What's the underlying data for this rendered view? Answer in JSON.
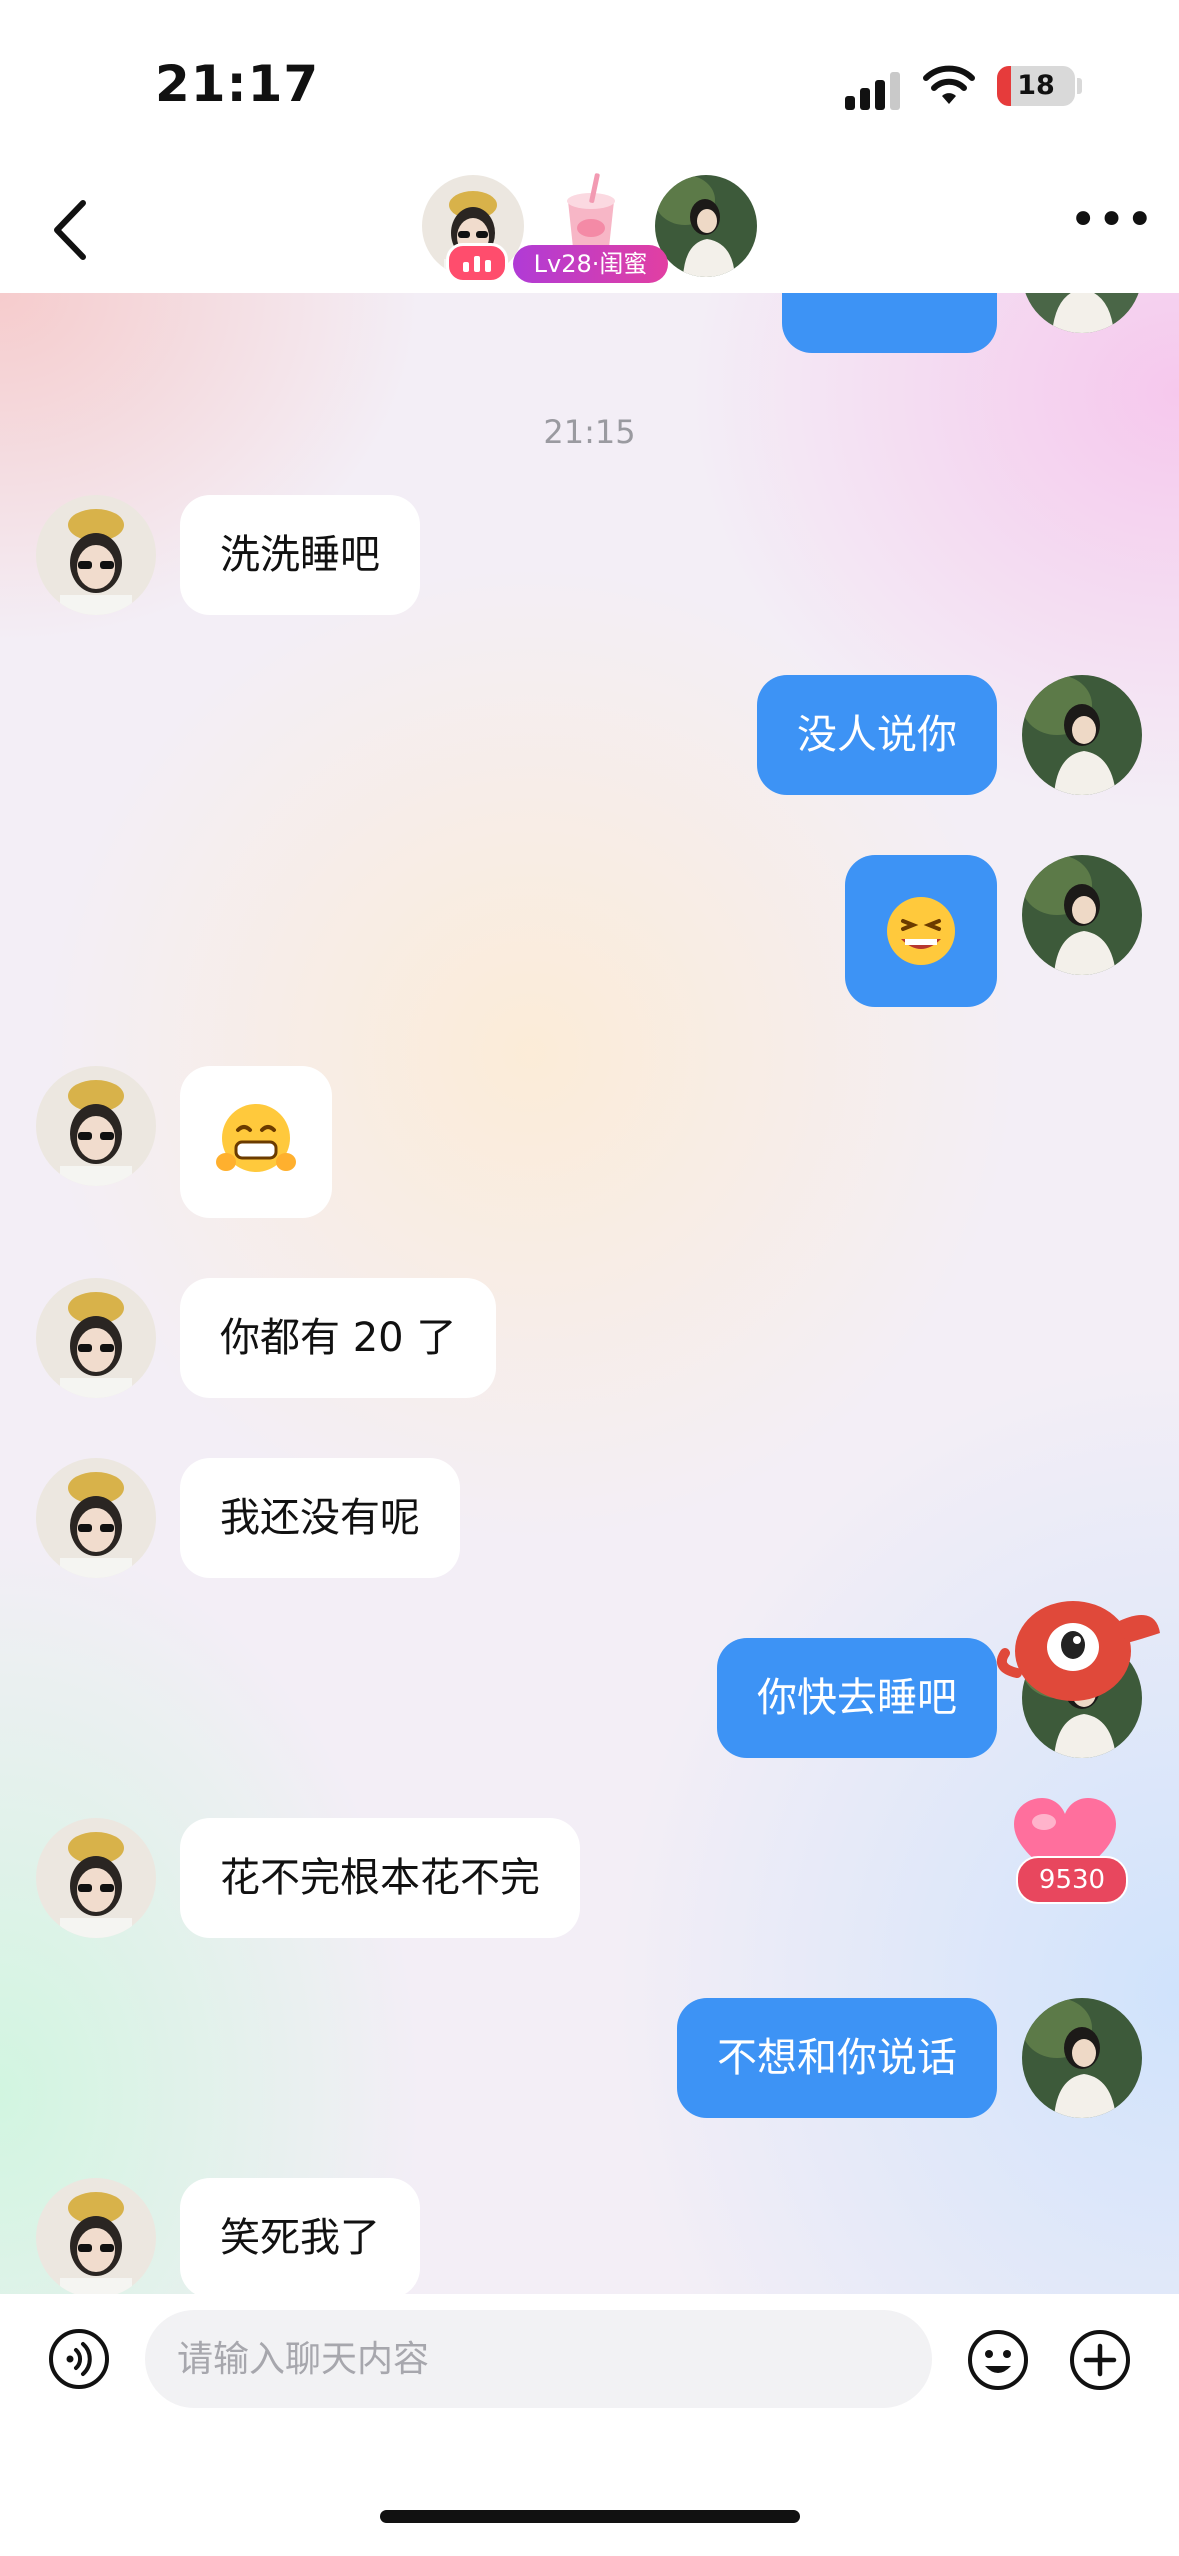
{
  "status_bar": {
    "time": "21:17",
    "battery_level": "18"
  },
  "header": {
    "level_badge": "Lv28·闺蜜",
    "more_icon": "more-icon",
    "back_icon": "back-icon"
  },
  "chat": {
    "timestamp": "21:15",
    "messages": [
      {
        "side": "in",
        "text": "洗洗睡吧"
      },
      {
        "side": "out",
        "text": "没人说你"
      },
      {
        "side": "out",
        "emoji": "grinning-squint-emoji"
      },
      {
        "side": "in",
        "emoji": "grin-hands-emoji"
      },
      {
        "side": "in",
        "text": "你都有 20 了"
      },
      {
        "side": "in",
        "text": "我还没有呢"
      },
      {
        "side": "out",
        "text": "你快去睡吧"
      },
      {
        "side": "in",
        "text": "花不完根本花不完"
      },
      {
        "side": "out",
        "text": "不想和你说话"
      },
      {
        "side": "in",
        "text": "笑死我了"
      }
    ],
    "heart_count": "9530"
  },
  "input": {
    "placeholder": "请输入聊天内容",
    "value": ""
  },
  "colors": {
    "outgoing_bubble": "#3d93f5",
    "incoming_bubble": "#ffffff",
    "level_badge": "#c13cc4",
    "heart_badge": "#e8475e"
  }
}
